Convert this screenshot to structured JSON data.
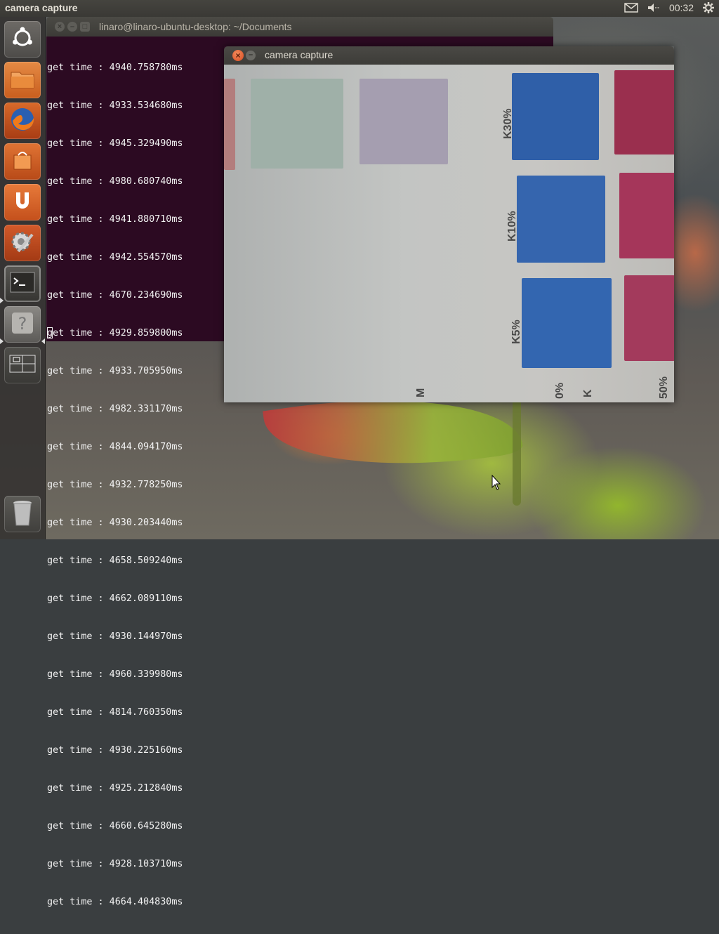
{
  "top_panel": {
    "active_title": "camera capture",
    "clock": "00:32",
    "icons": [
      "mail-icon",
      "volume-icon",
      "settings-gear-icon"
    ]
  },
  "launcher": {
    "items": [
      {
        "name": "dash-home",
        "icon": "ubuntu-logo-icon"
      },
      {
        "name": "files",
        "icon": "folder-icon"
      },
      {
        "name": "firefox",
        "icon": "firefox-icon"
      },
      {
        "name": "software-center",
        "icon": "shopping-bag-icon"
      },
      {
        "name": "ubuntu-one",
        "icon": "ubuntu-one-icon"
      },
      {
        "name": "system-settings",
        "icon": "settings-tools-icon"
      },
      {
        "name": "terminal",
        "icon": "terminal-icon"
      },
      {
        "name": "help",
        "icon": "help-icon"
      },
      {
        "name": "workspace-switcher",
        "icon": "workspace-icon"
      },
      {
        "name": "trash",
        "icon": "trash-icon"
      }
    ]
  },
  "terminal": {
    "title": "linaro@linaro-ubuntu-desktop: ~/Documents",
    "lines": [
      "get time : 4940.758780ms",
      "get time : 4933.534680ms",
      "get time : 4945.329490ms",
      "get time : 4980.680740ms",
      "get time : 4941.880710ms",
      "get time : 4942.554570ms",
      "get time : 4670.234690ms",
      "get time : 4929.859800ms",
      "get time : 4933.705950ms",
      "get time : 4982.331170ms",
      "get time : 4844.094170ms",
      "get time : 4932.778250ms",
      "get time : 4930.203440ms",
      "get time : 4658.509240ms",
      "get time : 4662.089110ms",
      "get time : 4930.144970ms",
      "get time : 4960.339980ms",
      "get time : 4814.760350ms",
      "get time : 4930.225160ms",
      "get time : 4925.212840ms",
      "get time : 4660.645280ms",
      "get time : 4928.103710ms",
      "get time : 4664.404830ms"
    ]
  },
  "camera_window": {
    "title": "camera capture",
    "labels": [
      "K30%",
      "K10%",
      "K5%",
      "0%",
      "50%",
      "M",
      "K"
    ]
  },
  "colors": {
    "terminal_bg": "#2c0a22",
    "panel_bg": "#3c3b37",
    "close_button": "#e0592a",
    "swatch_blue": "#2f5fa8",
    "swatch_magenta": "#9a2f4e"
  }
}
